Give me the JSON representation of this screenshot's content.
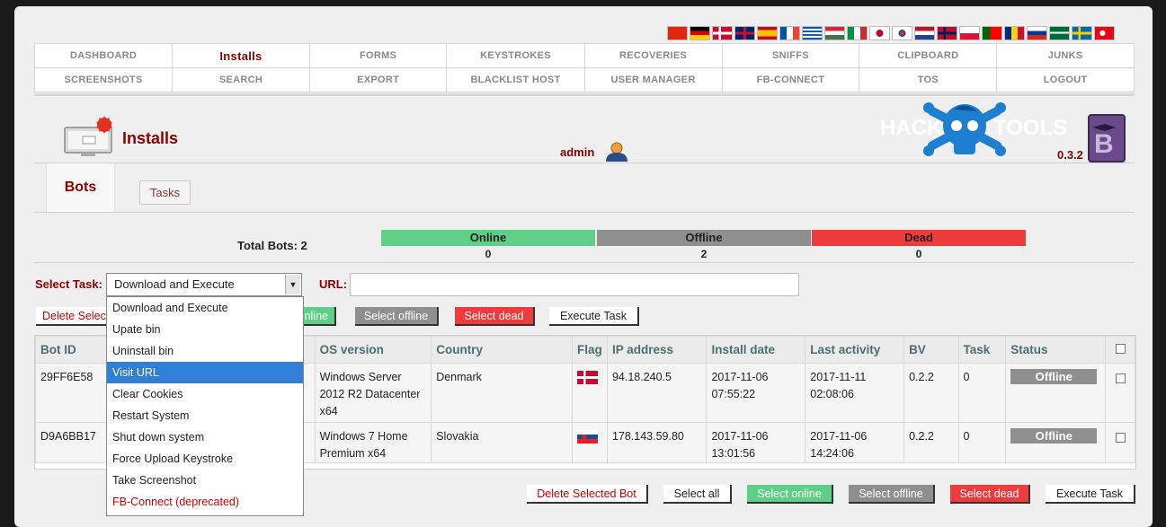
{
  "nav": {
    "row1": [
      "DASHBOARD",
      "Installs",
      "FORMS",
      "KEYSTROKES",
      "RECOVERIES",
      "SNIFFS",
      "CLIPBOARD",
      "JUNKS"
    ],
    "row2": [
      "SCREENSHOTS",
      "SEARCH",
      "EXPORT",
      "BLACKLIST HOST",
      "USER MANAGER",
      "FB-CONNECT",
      "TOS",
      "LOGOUT"
    ],
    "active": "Installs"
  },
  "language_flags": [
    "cn-flag-icon",
    "de-flag-icon",
    "dk-flag-icon",
    "gb-flag-icon",
    "es-flag-icon",
    "fr-flag-icon",
    "gr-flag-icon",
    "hu-flag-icon",
    "it-flag-icon",
    "jp-flag-icon",
    "kr-flag-icon",
    "nl-flag-icon",
    "no-flag-icon",
    "pl-flag-icon",
    "pt-flag-icon",
    "ro-flag-icon",
    "ru-flag-icon",
    "sa-flag-icon",
    "se-flag-icon",
    "tr-flag-icon"
  ],
  "header": {
    "page_title": "Installs",
    "username": "admin",
    "logo_text_left": "HACK",
    "logo_text_right": "TOOLS",
    "version": "0.3.2"
  },
  "tabs": {
    "bots": "Bots",
    "tasks": "Tasks"
  },
  "stats": {
    "total_label": "Total Bots: 2",
    "online_label": "Online",
    "online_count": "0",
    "offline_label": "Offline",
    "offline_count": "2",
    "dead_label": "Dead",
    "dead_count": "0"
  },
  "task_form": {
    "select_label": "Select Task:",
    "selected_task": "Download and Execute",
    "url_label": "URL:",
    "url_value": "",
    "options": [
      "Download and Execute",
      "Upate bin",
      "Uninstall bin",
      "Visit URL",
      "Clear Cookies",
      "Restart System",
      "Shut down system",
      "Force Upload Keystroke",
      "Take Screenshot",
      "FB-Connect (deprecated)"
    ],
    "highlighted_option": "Visit URL"
  },
  "buttons": {
    "delete_selected": "Delete Selected Bot",
    "delete_selected_partial": "Delete Selec",
    "select_all": "Select all",
    "select_online": "Select online",
    "select_online_partial": "nline",
    "select_offline": "Select offline",
    "select_dead": "Select dead",
    "execute_task": "Execute Task"
  },
  "table": {
    "columns": [
      "Bot ID",
      "",
      "OS version",
      "Country",
      "Flag",
      "IP address",
      "Install date",
      "Last activity",
      "BV",
      "Task",
      "Status",
      ""
    ],
    "rows": [
      {
        "bot_id": "29FF6E58",
        "os": "Windows Server 2012 R2 Datacenter x64",
        "country": "Denmark",
        "flag": "dk-flag-icon",
        "ip": "94.18.240.5",
        "install_date": "2017-11-06 07:55:22",
        "last_activity": "2017-11-11 02:08:06",
        "bv": "0.2.2",
        "task": "0",
        "status": "Offline"
      },
      {
        "bot_id": "D9A6BB17",
        "os": "Windows 7 Home Premium x64",
        "country": "Slovakia",
        "flag": "sk-flag-icon",
        "ip": "178.143.59.80",
        "install_date": "2017-11-06 13:01:56",
        "last_activity": "2017-11-06 14:24:06",
        "bv": "0.2.2",
        "task": "0",
        "status": "Offline"
      }
    ]
  },
  "colors": {
    "accent_red": "#8b0000",
    "online": "#5fcf87",
    "offline": "#8f8f8f",
    "dead": "#ee3b3b",
    "logo_blue": "#1e7fd1",
    "dropdown_highlight": "#2f80d6"
  }
}
